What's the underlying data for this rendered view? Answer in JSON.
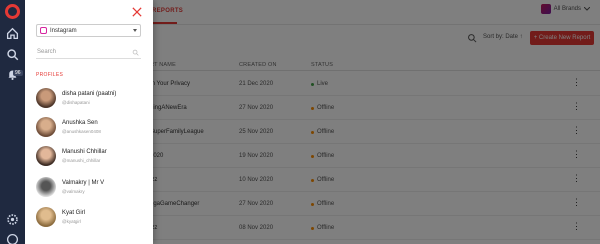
{
  "rail": {
    "icons": [
      "home-icon",
      "search-icon",
      "bell-icon",
      "settings-icon",
      "help-icon"
    ],
    "badge": "96"
  },
  "header": {
    "tab_reports": "REPORTS",
    "brand_label": "All Brands"
  },
  "toolbar": {
    "sort_label": "Sort by: Date ↑",
    "create_label": "+ Create New Report"
  },
  "table": {
    "columns": [
      "RT NAME",
      "CREATED ON",
      "STATUS"
    ],
    "rows": [
      {
        "name": "m Your Privacy",
        "date": "21 Dec 2020",
        "status": "Live"
      },
      {
        "name": "ningANewEra",
        "date": "27 Nov 2020",
        "status": "Offline"
      },
      {
        "name": "SuperFamilyLeague",
        "date": "25 Nov 2020",
        "status": "Offline"
      },
      {
        "name": "2020",
        "date": "19 Nov 2020",
        "status": "Offline"
      },
      {
        "name": "izz",
        "date": "10 Nov 2020",
        "status": "Offline"
      },
      {
        "name": "egaGameChanger",
        "date": "27 Nov 2020",
        "status": "Offline"
      },
      {
        "name": "izz",
        "date": "08 Nov 2020",
        "status": "Offline"
      }
    ]
  },
  "drawer": {
    "platform": "Instagram",
    "search_placeholder": "Search",
    "profiles_heading": "PROFILES",
    "profiles": [
      {
        "name": "disha patani (paatni)",
        "handle": "@dishapatani"
      },
      {
        "name": "Anushka Sen",
        "handle": "@anushkasen0408"
      },
      {
        "name": "Manushi Chhillar",
        "handle": "@manushi_chhillar"
      },
      {
        "name": "Valmakry | Mr V",
        "handle": "@valmakry"
      },
      {
        "name": "Kyat Girl",
        "handle": "@kyatgirl"
      }
    ]
  },
  "colors": {
    "accent": "#e53935",
    "rail": "#1f2940",
    "live": "#43a047",
    "offline": "#fb8c00"
  }
}
